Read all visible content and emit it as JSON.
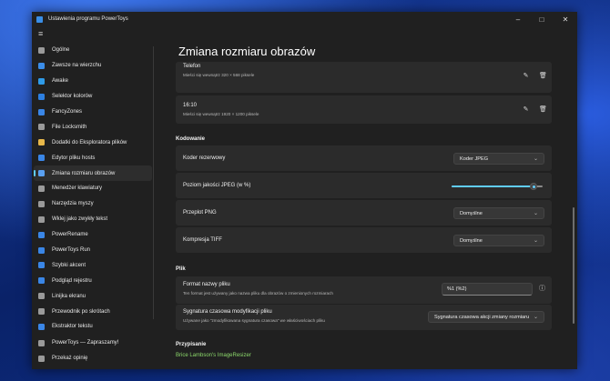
{
  "window": {
    "title": "Ustawienia programu PowerToys",
    "accent": "#60cdff"
  },
  "nav": {
    "items": [
      {
        "label": "Ogólne",
        "icon": "gear-icon",
        "color": "#9a9a9a"
      },
      {
        "label": "Zawsze na wierzchu",
        "icon": "pin-icon",
        "color": "#3b8de8"
      },
      {
        "label": "Awake",
        "icon": "coffee-icon",
        "color": "#2f9be8"
      },
      {
        "label": "Selektor kolorów",
        "icon": "color-picker-icon",
        "color": "#2d7fe0"
      },
      {
        "label": "FancyZones",
        "icon": "fancyzones-icon",
        "color": "#3a86e6"
      },
      {
        "label": "File Locksmith",
        "icon": "lock-icon",
        "color": "#9a9a9a"
      },
      {
        "label": "Dodatki do Eksploratora plików",
        "icon": "folder-icon",
        "color": "#e8b84a"
      },
      {
        "label": "Edytor pliku hosts",
        "icon": "hosts-icon",
        "color": "#3a86e6"
      },
      {
        "label": "Zmiana rozmiaru obrazów",
        "icon": "image-resizer-icon",
        "color": "#5aa0f0"
      },
      {
        "label": "Menedżer klawiatury",
        "icon": "keyboard-icon",
        "color": "#9a9a9a"
      },
      {
        "label": "Narzędzia myszy",
        "icon": "mouse-icon",
        "color": "#9a9a9a"
      },
      {
        "label": "Wklej jako zwykły tekst",
        "icon": "paste-icon",
        "color": "#9a9a9a"
      },
      {
        "label": "PowerRename",
        "icon": "rename-icon",
        "color": "#3a86e6"
      },
      {
        "label": "PowerToys Run",
        "icon": "run-icon",
        "color": "#3a86e6"
      },
      {
        "label": "Szybki akcent",
        "icon": "accent-icon",
        "color": "#3a86e6"
      },
      {
        "label": "Podgląd rejestru",
        "icon": "registry-icon",
        "color": "#3a86e6"
      },
      {
        "label": "Linijka ekranu",
        "icon": "ruler-icon",
        "color": "#9a9a9a"
      },
      {
        "label": "Przewodnik po skrótach",
        "icon": "shortcut-guide-icon",
        "color": "#9a9a9a"
      },
      {
        "label": "Ekstraktor tekstu",
        "icon": "text-extractor-icon",
        "color": "#3a86e6"
      }
    ],
    "footer": [
      {
        "label": "PowerToys — Zapraszamy!",
        "icon": "welcome-icon",
        "color": "#9a9a9a"
      },
      {
        "label": "Przekaż opinię",
        "icon": "feedback-icon",
        "color": "#9a9a9a"
      }
    ]
  },
  "page": {
    "title": "Zmiana rozmiaru obrazów",
    "presets": [
      {
        "name": "Telefon",
        "desc_prefix": "Mieści się wewnątrz",
        "w": "320",
        "x": "×",
        "h": "568",
        "unit": "piksele"
      },
      {
        "name": "16:10",
        "desc_prefix": "Mieści się wewnątrz",
        "w": "1920",
        "x": "×",
        "h": "1200",
        "unit": "piksele"
      }
    ],
    "encoding": {
      "header": "Kodowanie",
      "fallback_label": "Koder rezerwowy",
      "fallback_value": "Koder JPEG",
      "jpeg_quality_label": "Poziom jakości JPEG (w %)",
      "jpeg_quality": 0.9,
      "png_label": "Przeplot PNG",
      "png_value": "Domyślne",
      "tiff_label": "Kompresja TIFF",
      "tiff_value": "Domyślne"
    },
    "file": {
      "header": "Plik",
      "format_label": "Format nazwy pliku",
      "format_desc": "Ten format jest używany jako nazwa pliku dla obrazów o zmienionych rozmiarach",
      "format_value": "%1 (%2)",
      "timestamp_label": "Sygnatura czasowa modyfikacji pliku",
      "timestamp_desc": "Używane jako \"zmodyfikowana sygnatura czasowa\" we właściwościach pliku",
      "timestamp_value": "Sygnatura czasowa akcji zmiany rozmiaru"
    },
    "attribution": {
      "header": "Przypisanie",
      "link": "Brice Lambson's ImageResizer"
    }
  }
}
